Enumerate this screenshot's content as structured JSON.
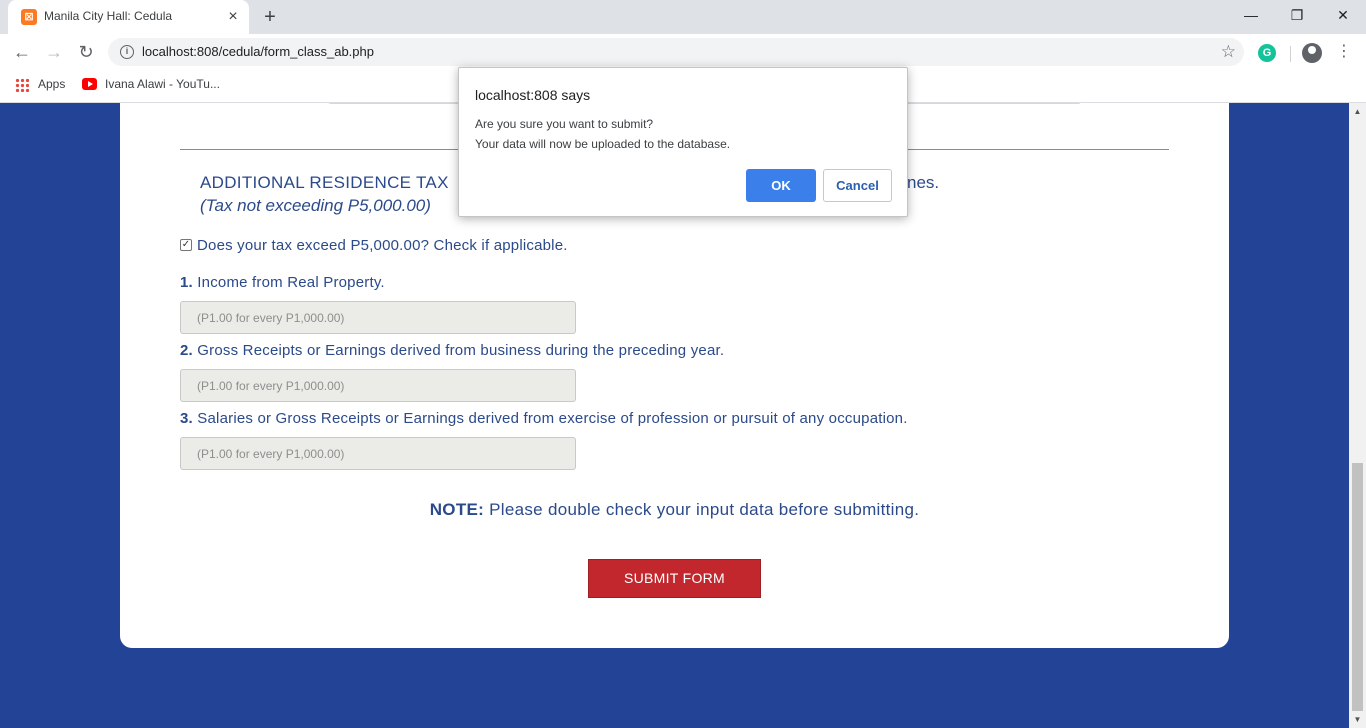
{
  "browser": {
    "tab_title": "Manila City Hall: Cedula",
    "favicon_glyph": "⊠",
    "close_glyph": "×",
    "newtab_glyph": "+",
    "url": "localhost:808/cedula/form_class_ab.php",
    "bookmarks": [
      {
        "label": "Apps"
      },
      {
        "label": "Ivana Alawi - YouTu..."
      }
    ],
    "window": {
      "minimize": "—",
      "restore": "❐",
      "close": "✕"
    },
    "nav": {
      "back": "←",
      "forward": "→",
      "reload": "↻"
    },
    "extension_glyph": "G",
    "star_glyph": "☆",
    "menu_glyph": "⋮"
  },
  "form": {
    "section_title": "ADDITIONAL RESIDENCE TAX",
    "section_title_tail": "nes.",
    "section_subtitle": "(Tax not exceeding P5,000.00)",
    "checkbox_checked": true,
    "checkbox_mark": "✓",
    "checkbox_label": "Does your tax exceed P5,000.00? Check if applicable.",
    "questions": [
      {
        "num": "1.",
        "label": "Income from Real Property.",
        "placeholder": "(P1.00 for every P1,000.00)"
      },
      {
        "num": "2.",
        "label": "Gross Receipts or Earnings derived from business during the preceding year.",
        "placeholder": "(P1.00 for every P1,000.00)"
      },
      {
        "num": "3.",
        "label": "Salaries or Gross Receipts or Earnings derived from exercise of profession or pursuit of any occupation.",
        "placeholder": "(P1.00 for every P1,000.00)"
      }
    ],
    "note_label": "NOTE:",
    "note_text": "Please double check your input data before submitting.",
    "submit_label": "SUBMIT FORM"
  },
  "dialog": {
    "title": "localhost:808 says",
    "line1": "Are you sure you want to submit?",
    "line2": "Your data will now be uploaded to the database.",
    "ok_label": "OK",
    "cancel_label": "Cancel"
  },
  "colors": {
    "page_background": "#234396",
    "text_blue": "#2b4a8a",
    "submit_red": "#c1272d",
    "dialog_ok": "#3b80ea"
  }
}
